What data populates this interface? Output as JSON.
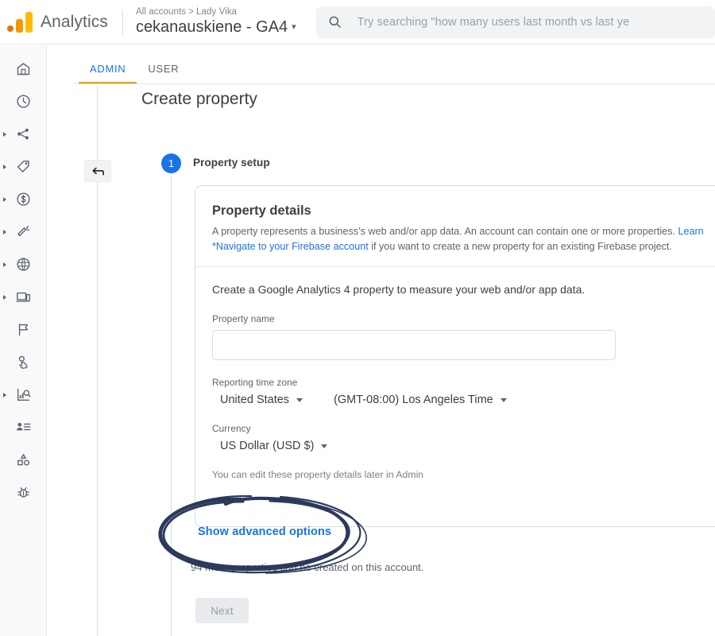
{
  "header": {
    "logo_icon": "analytics-logo-icon",
    "brand": "Analytics",
    "breadcrumb_root": "All accounts",
    "breadcrumb_sep": ">",
    "breadcrumb_account": "Lady Vika",
    "property_title": "cekanauskiene - GA4",
    "property_caret": "▾",
    "search": {
      "icon": "search-icon",
      "placeholder": "Try searching \"how many users last month vs last ye"
    }
  },
  "sidebar": {
    "items": [
      {
        "name": "home",
        "icon": "home-icon",
        "expandable": false
      },
      {
        "name": "reports-snapshot",
        "icon": "clock-icon",
        "expandable": false
      },
      {
        "name": "acquisition",
        "icon": "share-nodes-icon",
        "expandable": true
      },
      {
        "name": "engagement",
        "icon": "tag-icon",
        "expandable": true
      },
      {
        "name": "monetization",
        "icon": "dollar-circle-icon",
        "expandable": true
      },
      {
        "name": "retention",
        "icon": "magic-wand-icon",
        "expandable": true
      },
      {
        "name": "demographics",
        "icon": "globe-icon",
        "expandable": true
      },
      {
        "name": "tech",
        "icon": "devices-icon",
        "expandable": true
      },
      {
        "name": "conversions",
        "icon": "flag-icon",
        "expandable": false
      },
      {
        "name": "events",
        "icon": "touch-hand-icon",
        "expandable": false
      },
      {
        "name": "explore",
        "icon": "chart-search-icon",
        "expandable": true
      },
      {
        "name": "audiences",
        "icon": "person-list-icon",
        "expandable": false
      },
      {
        "name": "segments",
        "icon": "shapes-icon",
        "expandable": false
      },
      {
        "name": "debug-view",
        "icon": "bug-icon",
        "expandable": false
      }
    ]
  },
  "tabs": [
    {
      "label": "ADMIN",
      "active": true
    },
    {
      "label": "USER",
      "active": false
    }
  ],
  "page": {
    "title": "Create property",
    "back_button_icon": "back-arrow-icon",
    "step": {
      "number": "1",
      "label": "Property setup"
    }
  },
  "card": {
    "heading": "Property details",
    "desc_line1_pre": "A property represents a business’s web and/or app data. An account can contain one or more properties. ",
    "desc_line1_link": "Learn",
    "desc_line2_link": "*Navigate to your Firebase account",
    "desc_line2_post": " if you want to create a new property for an existing Firebase project.",
    "lead": "Create a Google Analytics 4 property to measure your web and/or app data.",
    "property_name_label": "Property name",
    "property_name_value": "",
    "property_name_placeholder": "",
    "timezone_label": "Reporting time zone",
    "timezone_country": "United States",
    "timezone_zone": "(GMT-08:00) Los Angeles Time",
    "currency_label": "Currency",
    "currency_value": "US Dollar (USD $)",
    "edit_hint": "You can edit these property details later in Admin",
    "caret": "▾"
  },
  "footer": {
    "advanced_options": "Show advanced options",
    "more_properties": "94 more properties can be created on this account.",
    "next_button": "Next"
  },
  "annotation": {
    "name": "hand-drawn-ellipse",
    "color": "#2b3a5c",
    "target": "Show advanced options"
  },
  "colors": {
    "accent_blue": "#1a73e8",
    "tab_underline": "#f29900",
    "logo_orange": "#f29900",
    "logo_yellow": "#fbbc04",
    "logo_red_orange": "#e8710a",
    "annotation": "#2b3a5c"
  }
}
